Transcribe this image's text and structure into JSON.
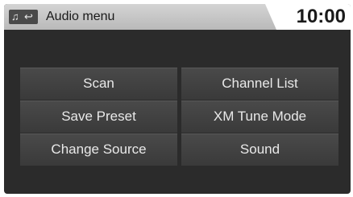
{
  "header": {
    "icons": [
      "music-note-icon",
      "back-arrow-icon"
    ],
    "title": "Audio menu",
    "clock": "10:00"
  },
  "menu": {
    "buttons": [
      {
        "label": "Scan"
      },
      {
        "label": "Channel List"
      },
      {
        "label": "Save Preset"
      },
      {
        "label": "XM Tune Mode"
      },
      {
        "label": "Change Source"
      },
      {
        "label": "Sound"
      }
    ]
  },
  "colors": {
    "screen_background": "#2b2b2b",
    "header_background": "#c8c8c8",
    "button_background": "#444444",
    "button_text": "#e9e9e9"
  }
}
